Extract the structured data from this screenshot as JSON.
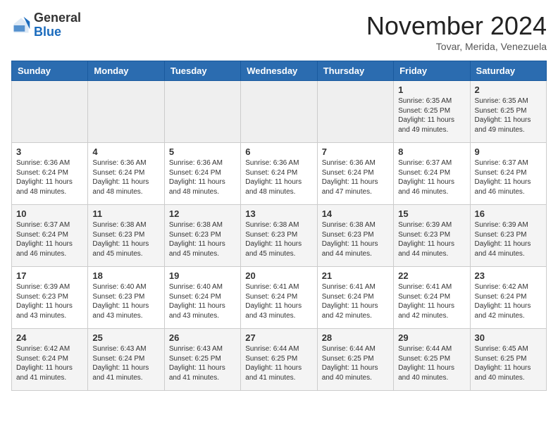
{
  "header": {
    "logo_general": "General",
    "logo_blue": "Blue",
    "month_title": "November 2024",
    "subtitle": "Tovar, Merida, Venezuela"
  },
  "days_of_week": [
    "Sunday",
    "Monday",
    "Tuesday",
    "Wednesday",
    "Thursday",
    "Friday",
    "Saturday"
  ],
  "weeks": [
    [
      {
        "day": "",
        "info": ""
      },
      {
        "day": "",
        "info": ""
      },
      {
        "day": "",
        "info": ""
      },
      {
        "day": "",
        "info": ""
      },
      {
        "day": "",
        "info": ""
      },
      {
        "day": "1",
        "info": "Sunrise: 6:35 AM\nSunset: 6:25 PM\nDaylight: 11 hours and 49 minutes."
      },
      {
        "day": "2",
        "info": "Sunrise: 6:35 AM\nSunset: 6:25 PM\nDaylight: 11 hours and 49 minutes."
      }
    ],
    [
      {
        "day": "3",
        "info": "Sunrise: 6:36 AM\nSunset: 6:24 PM\nDaylight: 11 hours and 48 minutes."
      },
      {
        "day": "4",
        "info": "Sunrise: 6:36 AM\nSunset: 6:24 PM\nDaylight: 11 hours and 48 minutes."
      },
      {
        "day": "5",
        "info": "Sunrise: 6:36 AM\nSunset: 6:24 PM\nDaylight: 11 hours and 48 minutes."
      },
      {
        "day": "6",
        "info": "Sunrise: 6:36 AM\nSunset: 6:24 PM\nDaylight: 11 hours and 48 minutes."
      },
      {
        "day": "7",
        "info": "Sunrise: 6:36 AM\nSunset: 6:24 PM\nDaylight: 11 hours and 47 minutes."
      },
      {
        "day": "8",
        "info": "Sunrise: 6:37 AM\nSunset: 6:24 PM\nDaylight: 11 hours and 46 minutes."
      },
      {
        "day": "9",
        "info": "Sunrise: 6:37 AM\nSunset: 6:24 PM\nDaylight: 11 hours and 46 minutes."
      }
    ],
    [
      {
        "day": "10",
        "info": "Sunrise: 6:37 AM\nSunset: 6:24 PM\nDaylight: 11 hours and 46 minutes."
      },
      {
        "day": "11",
        "info": "Sunrise: 6:38 AM\nSunset: 6:23 PM\nDaylight: 11 hours and 45 minutes."
      },
      {
        "day": "12",
        "info": "Sunrise: 6:38 AM\nSunset: 6:23 PM\nDaylight: 11 hours and 45 minutes."
      },
      {
        "day": "13",
        "info": "Sunrise: 6:38 AM\nSunset: 6:23 PM\nDaylight: 11 hours and 45 minutes."
      },
      {
        "day": "14",
        "info": "Sunrise: 6:38 AM\nSunset: 6:23 PM\nDaylight: 11 hours and 44 minutes."
      },
      {
        "day": "15",
        "info": "Sunrise: 6:39 AM\nSunset: 6:23 PM\nDaylight: 11 hours and 44 minutes."
      },
      {
        "day": "16",
        "info": "Sunrise: 6:39 AM\nSunset: 6:23 PM\nDaylight: 11 hours and 44 minutes."
      }
    ],
    [
      {
        "day": "17",
        "info": "Sunrise: 6:39 AM\nSunset: 6:23 PM\nDaylight: 11 hours and 43 minutes."
      },
      {
        "day": "18",
        "info": "Sunrise: 6:40 AM\nSunset: 6:23 PM\nDaylight: 11 hours and 43 minutes."
      },
      {
        "day": "19",
        "info": "Sunrise: 6:40 AM\nSunset: 6:24 PM\nDaylight: 11 hours and 43 minutes."
      },
      {
        "day": "20",
        "info": "Sunrise: 6:41 AM\nSunset: 6:24 PM\nDaylight: 11 hours and 43 minutes."
      },
      {
        "day": "21",
        "info": "Sunrise: 6:41 AM\nSunset: 6:24 PM\nDaylight: 11 hours and 42 minutes."
      },
      {
        "day": "22",
        "info": "Sunrise: 6:41 AM\nSunset: 6:24 PM\nDaylight: 11 hours and 42 minutes."
      },
      {
        "day": "23",
        "info": "Sunrise: 6:42 AM\nSunset: 6:24 PM\nDaylight: 11 hours and 42 minutes."
      }
    ],
    [
      {
        "day": "24",
        "info": "Sunrise: 6:42 AM\nSunset: 6:24 PM\nDaylight: 11 hours and 41 minutes."
      },
      {
        "day": "25",
        "info": "Sunrise: 6:43 AM\nSunset: 6:24 PM\nDaylight: 11 hours and 41 minutes."
      },
      {
        "day": "26",
        "info": "Sunrise: 6:43 AM\nSunset: 6:25 PM\nDaylight: 11 hours and 41 minutes."
      },
      {
        "day": "27",
        "info": "Sunrise: 6:44 AM\nSunset: 6:25 PM\nDaylight: 11 hours and 41 minutes."
      },
      {
        "day": "28",
        "info": "Sunrise: 6:44 AM\nSunset: 6:25 PM\nDaylight: 11 hours and 40 minutes."
      },
      {
        "day": "29",
        "info": "Sunrise: 6:44 AM\nSunset: 6:25 PM\nDaylight: 11 hours and 40 minutes."
      },
      {
        "day": "30",
        "info": "Sunrise: 6:45 AM\nSunset: 6:25 PM\nDaylight: 11 hours and 40 minutes."
      }
    ]
  ]
}
